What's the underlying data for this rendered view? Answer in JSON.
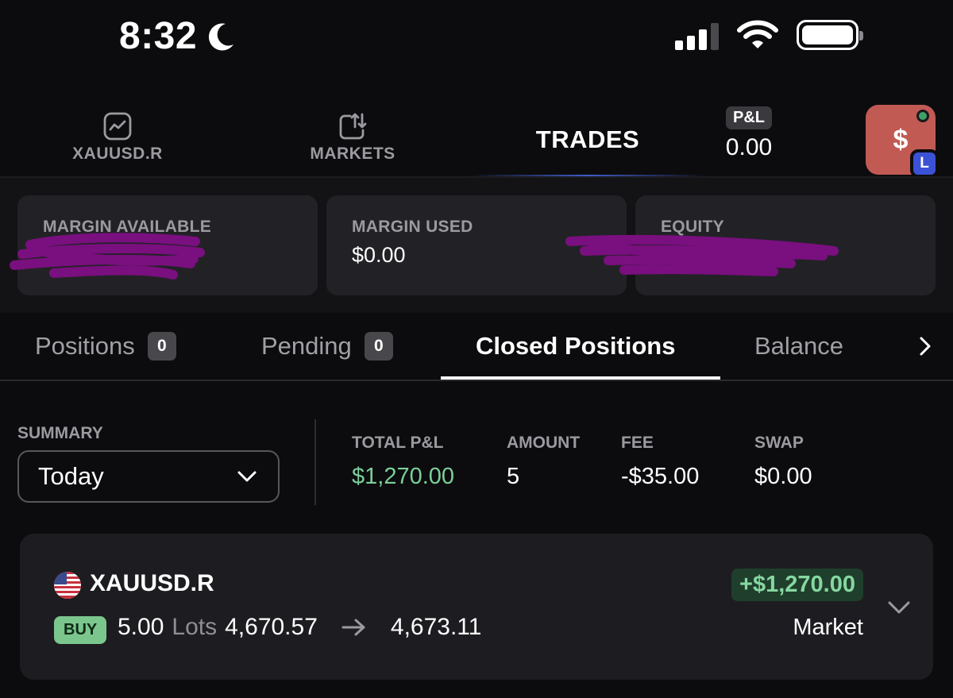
{
  "status_bar": {
    "time": "8:32"
  },
  "nav": {
    "items": [
      {
        "label": "XAUUSD.R",
        "icon": "chart-icon"
      },
      {
        "label": "MARKETS",
        "icon": "markets-icon"
      }
    ],
    "active": "TRADES",
    "pnl_label": "P&L",
    "pnl_value": "0.00",
    "avatar_symbol": "$",
    "avatar_badge": "L"
  },
  "cards": [
    {
      "label": "MARGIN AVAILABLE",
      "value": ""
    },
    {
      "label": "MARGIN USED",
      "value": "$0.00"
    },
    {
      "label": "EQUITY",
      "value": ""
    }
  ],
  "tabs": [
    {
      "label": "Positions",
      "count": "0"
    },
    {
      "label": "Pending",
      "count": "0"
    },
    {
      "label": "Closed Positions",
      "count": null
    },
    {
      "label": "Balance",
      "count": null
    }
  ],
  "summary": {
    "label": "SUMMARY",
    "period": "Today",
    "stats": [
      {
        "label": "TOTAL P&L",
        "value": "$1,270.00"
      },
      {
        "label": "AMOUNT",
        "value": "5"
      },
      {
        "label": "FEE",
        "value": "-$35.00"
      },
      {
        "label": "SWAP",
        "value": "$0.00"
      }
    ]
  },
  "trade": {
    "symbol": "XAUUSD.R",
    "side": "BUY",
    "lots": "5.00",
    "lots_label": "Lots",
    "open_price": "4,670.57",
    "close_price": "4,673.11",
    "profit": "+$1,270.00",
    "order_type": "Market"
  },
  "colors": {
    "background": "#0c0c0e",
    "card": "#222226",
    "profit_green": "#7ccf9a",
    "buy_badge": "#7bc68c",
    "avatar": "#c25a54",
    "accent_blue": "#3b52d6"
  }
}
